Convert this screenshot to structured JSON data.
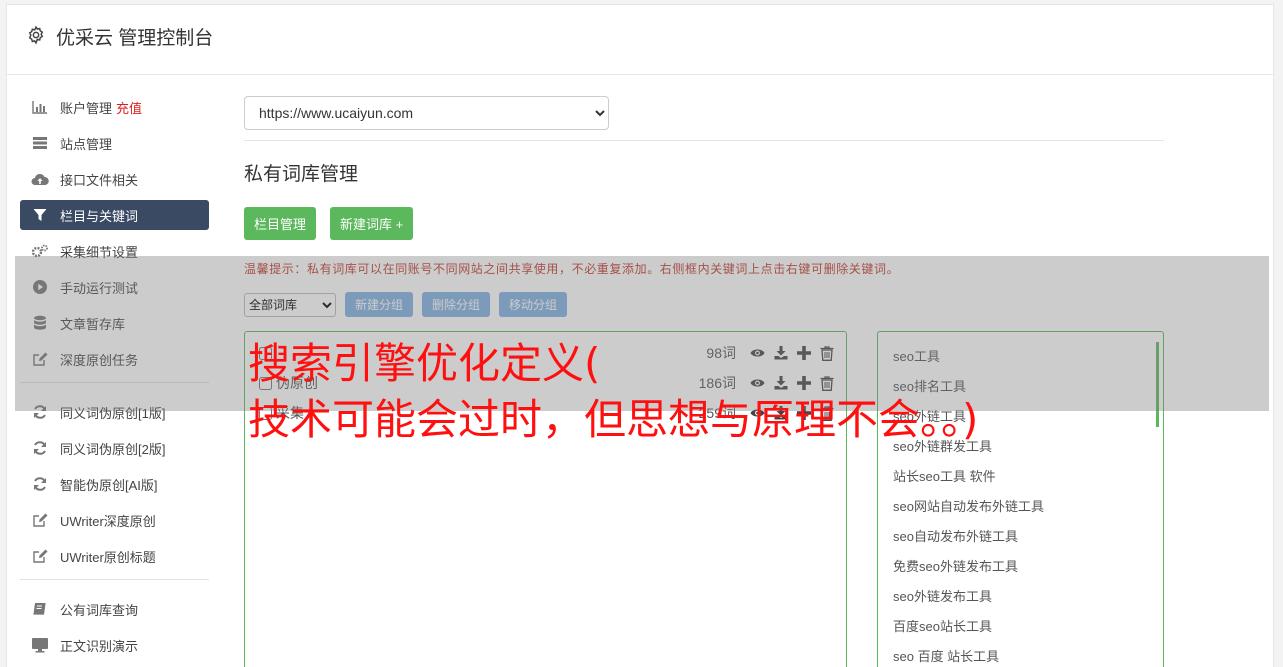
{
  "header": {
    "title": "优采云 管理控制台"
  },
  "sidebar": {
    "group1": [
      {
        "label": "账户管理",
        "icon": "bar-chart-icon",
        "extra": "充值"
      },
      {
        "label": "站点管理",
        "icon": "server-icon"
      },
      {
        "label": "接口文件相关",
        "icon": "cloud-upload-icon"
      },
      {
        "label": "栏目与关键词",
        "icon": "filter-icon",
        "active": true
      },
      {
        "label": "采集细节设置",
        "icon": "cogs-icon"
      },
      {
        "label": "手动运行测试",
        "icon": "play-circle-icon"
      },
      {
        "label": "文章暂存库",
        "icon": "database-icon"
      },
      {
        "label": "深度原创任务",
        "icon": "edit-icon"
      }
    ],
    "group2": [
      {
        "label": "同义词伪原创[1版]",
        "icon": "refresh-icon"
      },
      {
        "label": "同义词伪原创[2版]",
        "icon": "refresh-icon"
      },
      {
        "label": "智能伪原创[AI版]",
        "icon": "refresh-icon"
      },
      {
        "label": "UWriter深度原创",
        "icon": "edit-icon"
      },
      {
        "label": "UWriter原创标题",
        "icon": "edit-icon"
      }
    ],
    "group3": [
      {
        "label": "公有词库查询",
        "icon": "book-icon"
      },
      {
        "label": "正文识别演示",
        "icon": "monitor-icon"
      }
    ]
  },
  "main": {
    "site_select": "https://www.ucaiyun.com",
    "page_title": "私有词库管理",
    "btn_column": "栏目管理",
    "btn_new_lib": "新建词库 +",
    "tip": "温馨提示：私有词库可以在同账号不同网站之间共享使用，不必重复添加。右侧框内关键词上点击右键可删除关键词。",
    "lib_filter": "全部词库",
    "btn_new_group": "新建分组",
    "btn_del_group": "删除分组",
    "btn_move_group": "移动分组",
    "libraries": [
      {
        "name": "",
        "count": "98词"
      },
      {
        "name": "伪原创",
        "count": "186词"
      },
      {
        "name": "采集",
        "count": "259词"
      }
    ],
    "keywords": [
      "seo工具",
      "seo排名工具",
      "seo外链工具",
      "seo外链群发工具",
      "站长seo工具 软件",
      "seo网站自动发布外链工具",
      "seo自动发布外链工具",
      "免费seo外链发布工具",
      "seo外链发布工具",
      "百度seo站长工具",
      "seo 百度 站长工具"
    ]
  },
  "overlay": {
    "line1": "搜索引擎优化定义(",
    "line2": "技术可能会过时，但思想与原理不会。。)"
  }
}
